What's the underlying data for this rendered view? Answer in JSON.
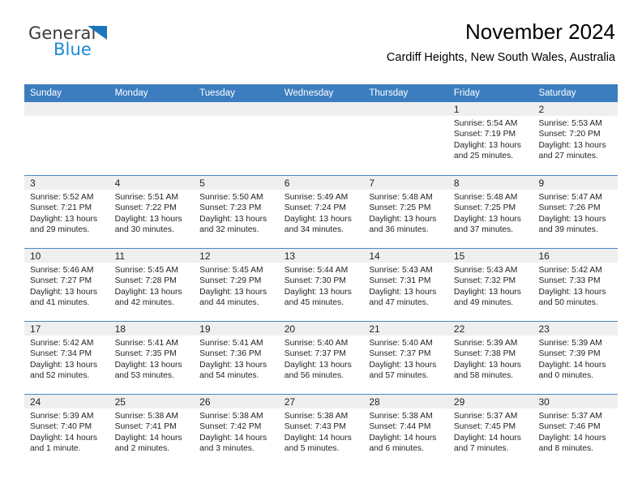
{
  "brand": {
    "name_part1": "General",
    "name_part2": "Blue",
    "triangle_color": "#1b75bb",
    "blue_color": "#1b8ad6",
    "dark_color": "#3b3b3d"
  },
  "header": {
    "title": "November 2024",
    "subtitle": "Cardiff Heights, New South Wales, Australia"
  },
  "theme": {
    "header_blue": "#3c7dbf",
    "row_divider": "#4a86c5",
    "day_band_gray": "#efefef",
    "text": "#231f20"
  },
  "weekdays": [
    "Sunday",
    "Monday",
    "Tuesday",
    "Wednesday",
    "Thursday",
    "Friday",
    "Saturday"
  ],
  "weeks": [
    [
      {
        "day": "",
        "sunrise": "",
        "sunset": "",
        "daylight1": "",
        "daylight2": ""
      },
      {
        "day": "",
        "sunrise": "",
        "sunset": "",
        "daylight1": "",
        "daylight2": ""
      },
      {
        "day": "",
        "sunrise": "",
        "sunset": "",
        "daylight1": "",
        "daylight2": ""
      },
      {
        "day": "",
        "sunrise": "",
        "sunset": "",
        "daylight1": "",
        "daylight2": ""
      },
      {
        "day": "",
        "sunrise": "",
        "sunset": "",
        "daylight1": "",
        "daylight2": ""
      },
      {
        "day": "1",
        "sunrise": "Sunrise: 5:54 AM",
        "sunset": "Sunset: 7:19 PM",
        "daylight1": "Daylight: 13 hours",
        "daylight2": "and 25 minutes."
      },
      {
        "day": "2",
        "sunrise": "Sunrise: 5:53 AM",
        "sunset": "Sunset: 7:20 PM",
        "daylight1": "Daylight: 13 hours",
        "daylight2": "and 27 minutes."
      }
    ],
    [
      {
        "day": "3",
        "sunrise": "Sunrise: 5:52 AM",
        "sunset": "Sunset: 7:21 PM",
        "daylight1": "Daylight: 13 hours",
        "daylight2": "and 29 minutes."
      },
      {
        "day": "4",
        "sunrise": "Sunrise: 5:51 AM",
        "sunset": "Sunset: 7:22 PM",
        "daylight1": "Daylight: 13 hours",
        "daylight2": "and 30 minutes."
      },
      {
        "day": "5",
        "sunrise": "Sunrise: 5:50 AM",
        "sunset": "Sunset: 7:23 PM",
        "daylight1": "Daylight: 13 hours",
        "daylight2": "and 32 minutes."
      },
      {
        "day": "6",
        "sunrise": "Sunrise: 5:49 AM",
        "sunset": "Sunset: 7:24 PM",
        "daylight1": "Daylight: 13 hours",
        "daylight2": "and 34 minutes."
      },
      {
        "day": "7",
        "sunrise": "Sunrise: 5:48 AM",
        "sunset": "Sunset: 7:25 PM",
        "daylight1": "Daylight: 13 hours",
        "daylight2": "and 36 minutes."
      },
      {
        "day": "8",
        "sunrise": "Sunrise: 5:48 AM",
        "sunset": "Sunset: 7:25 PM",
        "daylight1": "Daylight: 13 hours",
        "daylight2": "and 37 minutes."
      },
      {
        "day": "9",
        "sunrise": "Sunrise: 5:47 AM",
        "sunset": "Sunset: 7:26 PM",
        "daylight1": "Daylight: 13 hours",
        "daylight2": "and 39 minutes."
      }
    ],
    [
      {
        "day": "10",
        "sunrise": "Sunrise: 5:46 AM",
        "sunset": "Sunset: 7:27 PM",
        "daylight1": "Daylight: 13 hours",
        "daylight2": "and 41 minutes."
      },
      {
        "day": "11",
        "sunrise": "Sunrise: 5:45 AM",
        "sunset": "Sunset: 7:28 PM",
        "daylight1": "Daylight: 13 hours",
        "daylight2": "and 42 minutes."
      },
      {
        "day": "12",
        "sunrise": "Sunrise: 5:45 AM",
        "sunset": "Sunset: 7:29 PM",
        "daylight1": "Daylight: 13 hours",
        "daylight2": "and 44 minutes."
      },
      {
        "day": "13",
        "sunrise": "Sunrise: 5:44 AM",
        "sunset": "Sunset: 7:30 PM",
        "daylight1": "Daylight: 13 hours",
        "daylight2": "and 45 minutes."
      },
      {
        "day": "14",
        "sunrise": "Sunrise: 5:43 AM",
        "sunset": "Sunset: 7:31 PM",
        "daylight1": "Daylight: 13 hours",
        "daylight2": "and 47 minutes."
      },
      {
        "day": "15",
        "sunrise": "Sunrise: 5:43 AM",
        "sunset": "Sunset: 7:32 PM",
        "daylight1": "Daylight: 13 hours",
        "daylight2": "and 49 minutes."
      },
      {
        "day": "16",
        "sunrise": "Sunrise: 5:42 AM",
        "sunset": "Sunset: 7:33 PM",
        "daylight1": "Daylight: 13 hours",
        "daylight2": "and 50 minutes."
      }
    ],
    [
      {
        "day": "17",
        "sunrise": "Sunrise: 5:42 AM",
        "sunset": "Sunset: 7:34 PM",
        "daylight1": "Daylight: 13 hours",
        "daylight2": "and 52 minutes."
      },
      {
        "day": "18",
        "sunrise": "Sunrise: 5:41 AM",
        "sunset": "Sunset: 7:35 PM",
        "daylight1": "Daylight: 13 hours",
        "daylight2": "and 53 minutes."
      },
      {
        "day": "19",
        "sunrise": "Sunrise: 5:41 AM",
        "sunset": "Sunset: 7:36 PM",
        "daylight1": "Daylight: 13 hours",
        "daylight2": "and 54 minutes."
      },
      {
        "day": "20",
        "sunrise": "Sunrise: 5:40 AM",
        "sunset": "Sunset: 7:37 PM",
        "daylight1": "Daylight: 13 hours",
        "daylight2": "and 56 minutes."
      },
      {
        "day": "21",
        "sunrise": "Sunrise: 5:40 AM",
        "sunset": "Sunset: 7:37 PM",
        "daylight1": "Daylight: 13 hours",
        "daylight2": "and 57 minutes."
      },
      {
        "day": "22",
        "sunrise": "Sunrise: 5:39 AM",
        "sunset": "Sunset: 7:38 PM",
        "daylight1": "Daylight: 13 hours",
        "daylight2": "and 58 minutes."
      },
      {
        "day": "23",
        "sunrise": "Sunrise: 5:39 AM",
        "sunset": "Sunset: 7:39 PM",
        "daylight1": "Daylight: 14 hours",
        "daylight2": "and 0 minutes."
      }
    ],
    [
      {
        "day": "24",
        "sunrise": "Sunrise: 5:39 AM",
        "sunset": "Sunset: 7:40 PM",
        "daylight1": "Daylight: 14 hours",
        "daylight2": "and 1 minute."
      },
      {
        "day": "25",
        "sunrise": "Sunrise: 5:38 AM",
        "sunset": "Sunset: 7:41 PM",
        "daylight1": "Daylight: 14 hours",
        "daylight2": "and 2 minutes."
      },
      {
        "day": "26",
        "sunrise": "Sunrise: 5:38 AM",
        "sunset": "Sunset: 7:42 PM",
        "daylight1": "Daylight: 14 hours",
        "daylight2": "and 3 minutes."
      },
      {
        "day": "27",
        "sunrise": "Sunrise: 5:38 AM",
        "sunset": "Sunset: 7:43 PM",
        "daylight1": "Daylight: 14 hours",
        "daylight2": "and 5 minutes."
      },
      {
        "day": "28",
        "sunrise": "Sunrise: 5:38 AM",
        "sunset": "Sunset: 7:44 PM",
        "daylight1": "Daylight: 14 hours",
        "daylight2": "and 6 minutes."
      },
      {
        "day": "29",
        "sunrise": "Sunrise: 5:37 AM",
        "sunset": "Sunset: 7:45 PM",
        "daylight1": "Daylight: 14 hours",
        "daylight2": "and 7 minutes."
      },
      {
        "day": "30",
        "sunrise": "Sunrise: 5:37 AM",
        "sunset": "Sunset: 7:46 PM",
        "daylight1": "Daylight: 14 hours",
        "daylight2": "and 8 minutes."
      }
    ]
  ]
}
